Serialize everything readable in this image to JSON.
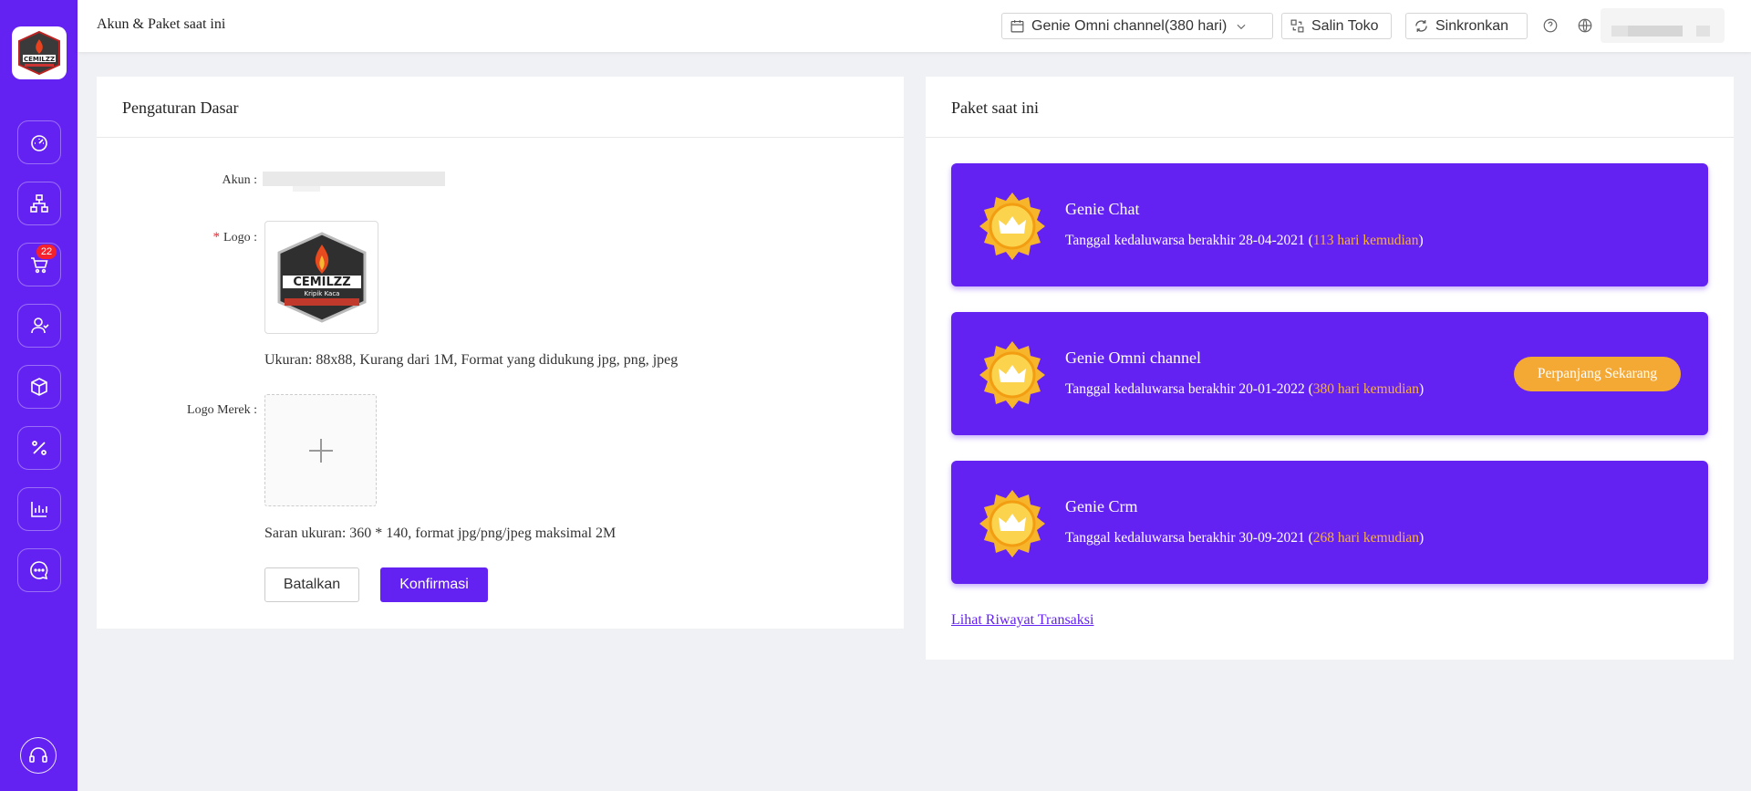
{
  "sidebar": {
    "logo_alt": "CEMILZZ",
    "items": [
      {
        "icon": "dashboard-icon"
      },
      {
        "icon": "store-network-icon"
      },
      {
        "icon": "cart-icon",
        "badge": "22"
      },
      {
        "icon": "customers-icon"
      },
      {
        "icon": "product-box-icon"
      },
      {
        "icon": "discount-icon"
      },
      {
        "icon": "analytics-icon"
      },
      {
        "icon": "chat-icon"
      }
    ],
    "support_icon": "headset-icon"
  },
  "topbar": {
    "title": "Akun & Paket saat ini",
    "store_selector": "Genie Omni channel(380 hari)",
    "copy_store": "Salin Toko",
    "sync": "Sinkronkan"
  },
  "basic_settings": {
    "title": "Pengaturan Dasar",
    "account_label": "Akun :",
    "logo_label": "Logo :",
    "logo_brand_text": "CEMILZZ",
    "logo_sub_text": "Kripik Kaca",
    "logo_hint": "Ukuran: 88x88, Kurang dari 1M, Format yang didukung jpg, png, jpeg",
    "brand_logo_label": "Logo Merek :",
    "brand_logo_hint": "Saran ukuran: 360 * 140, format jpg/png/jpeg maksimal 2M",
    "cancel": "Batalkan",
    "confirm": "Konfirmasi"
  },
  "current_plan": {
    "title": "Paket saat ini",
    "plans": [
      {
        "name": "Genie Chat",
        "exp_prefix": "Tanggal kedaluwarsa berakhir 28-04-2021 (",
        "days": "113 hari kemudian",
        "exp_suffix": ")"
      },
      {
        "name": "Genie Omni channel",
        "exp_prefix": "Tanggal kedaluwarsa berakhir 20-01-2022 (",
        "days": "380 hari kemudian",
        "exp_suffix": ")",
        "action": "Perpanjang Sekarang"
      },
      {
        "name": "Genie Crm",
        "exp_prefix": "Tanggal kedaluwarsa berakhir 30-09-2021 (",
        "days": "268 hari kemudian",
        "exp_suffix": ")"
      }
    ],
    "history_link": "Lihat Riwayat Transaksi"
  },
  "colors": {
    "primary": "#6422f2",
    "accent_orange": "#f5a935",
    "days_highlight": "#f9b13a",
    "badge_red": "#f5222d"
  }
}
